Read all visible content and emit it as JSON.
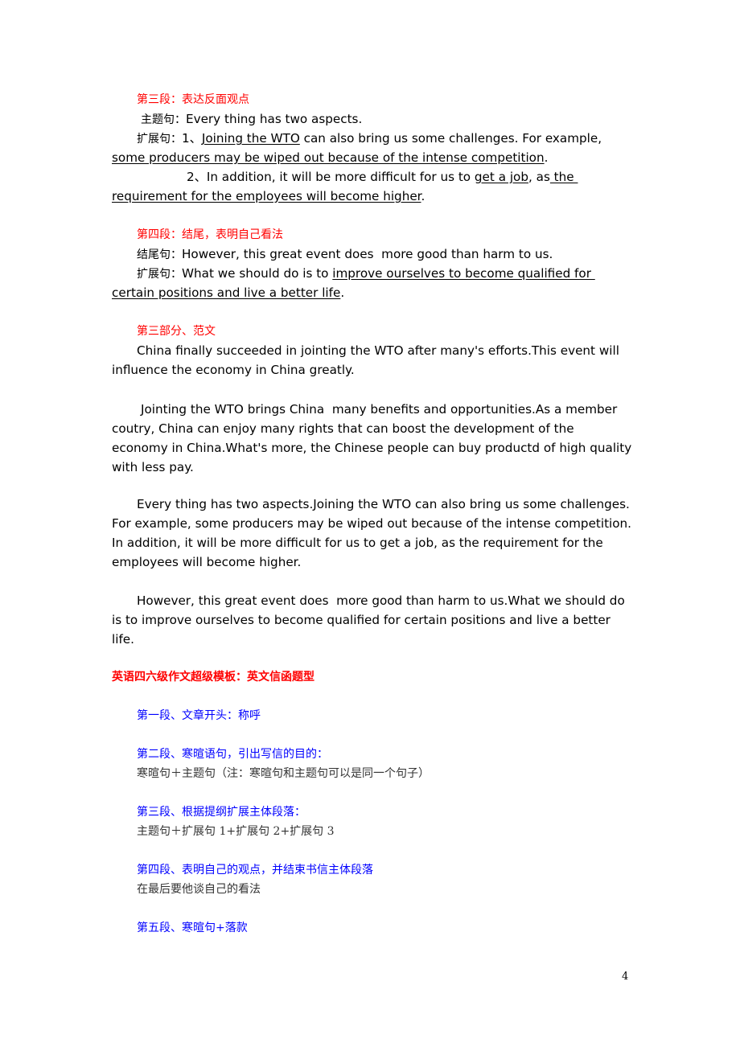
{
  "section3": {
    "heading": "第三段：表达反面观点",
    "topic_label": "主题句：",
    "topic_text": "Every thing has two aspects.",
    "ext_label": "扩展句：",
    "ext1_num": "1、",
    "ext1_u1": "Joining the WTO",
    "ext1_t1": " can also bring us some challenges. For example,",
    "ext1_u2": "some producers may be wiped out because of the intense competition",
    "ext1_end": ".",
    "ext2_num": "2、",
    "ext2_t1": "In addition, it will be more difficult for us to ",
    "ext2_u1": "get a job",
    "ext2_t2": ", as",
    "ext2_u2": " the ",
    "ext2_u3": "requirement for the employees will become higher",
    "ext2_end": "."
  },
  "section4": {
    "heading": "第四段：结尾，表明自己看法",
    "concl_label": "结尾句：",
    "concl_text": "However, this great event does  more good than harm to us.",
    "ext_label": "扩展句：",
    "ext_t1": "What we should do is to ",
    "ext_u1": "improve ourselves to become qualified for ",
    "ext_u2": "certain positions and live a better life",
    "ext_end": "."
  },
  "part3": {
    "heading": "第三部分、范文",
    "para1": [
      "China finally succeeded in jointing the WTO after many's efforts.This event will",
      "influence the economy in China greatly."
    ],
    "para2": [
      "Jointing the WTO brings China  many benefits and opportunities.As a member",
      "coutry, China can enjoy many rights that can boost the development of the",
      "economy in China.What's more, the Chinese people can buy productd of high quality",
      "with less pay."
    ],
    "para3": [
      "Every thing has two aspects.Joining the WTO can also bring us some challenges.",
      "For example, some producers may be wiped out because of the intense competition.",
      "In addition, it will be more difficult for us to get a job, as the requirement for the",
      "employees will become higher."
    ],
    "para4": [
      "However, this great event does  more good than harm to us.What we should do",
      "is to improve ourselves to become qualified for certain positions and live a better",
      "life."
    ]
  },
  "letter": {
    "title": "英语四六级作文超级模板：英文信函题型",
    "p1_heading": "第一段、文章开头：称呼",
    "p2_heading": "第二段、寒暄语句，引出写信的目的：",
    "p2_body": "寒暄句＋主题句（注：寒暄句和主题句可以是同一个句子）",
    "p3_heading": "第三段、根据提纲扩展主体段落：",
    "p3_body": "主题句＋扩展句 1+扩展句 2+扩展句 3",
    "p4_heading": "第四段、表明自己的观点，并结束书信主体段落",
    "p4_body": "在最后要他谈自己的看法",
    "p5_heading": "第五段、寒暄句+落款"
  },
  "page_number": "4",
  "colors": {
    "red": "#ff0000",
    "blue": "#0000ff",
    "text": "#000000"
  }
}
